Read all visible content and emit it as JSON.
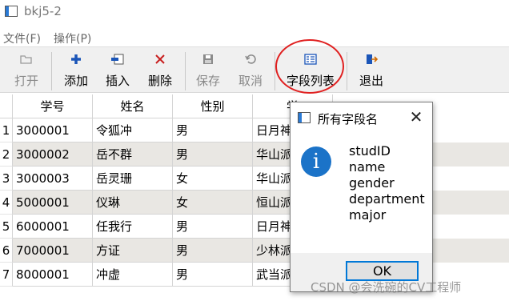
{
  "window": {
    "title": "bkj5-2"
  },
  "menu": {
    "items": [
      "文件(F)",
      "操作(P)"
    ]
  },
  "toolbar": {
    "buttons": [
      {
        "label": "打开",
        "icon": "folder-open-icon",
        "enabled": false
      },
      {
        "label": "添加",
        "icon": "plus-icon",
        "enabled": true
      },
      {
        "label": "插入",
        "icon": "insert-row-icon",
        "enabled": true
      },
      {
        "label": "删除",
        "icon": "delete-x-icon",
        "enabled": true
      },
      {
        "label": "保存",
        "icon": "save-disk-icon",
        "enabled": false
      },
      {
        "label": "取消",
        "icon": "undo-icon",
        "enabled": false
      },
      {
        "label": "字段列表",
        "icon": "field-list-icon",
        "enabled": true
      },
      {
        "label": "退出",
        "icon": "exit-door-icon",
        "enabled": true
      }
    ]
  },
  "table": {
    "headers": [
      "学号",
      "姓名",
      "性别",
      "学"
    ],
    "row_numbers": [
      "1",
      "2",
      "3",
      "4",
      "5",
      "6",
      "7"
    ],
    "rows": [
      [
        "3000001",
        "令狐冲",
        "男",
        "日月神"
      ],
      [
        "3000002",
        "岳不群",
        "男",
        "华山派"
      ],
      [
        "3000003",
        "岳灵珊",
        "女",
        "华山派"
      ],
      [
        "5000001",
        "仪琳",
        "女",
        "恒山派"
      ],
      [
        "6000001",
        "任我行",
        "男",
        "日月神"
      ],
      [
        "7000001",
        "方证",
        "男",
        "少林派"
      ],
      [
        "8000001",
        "冲虚",
        "男",
        "武当派"
      ]
    ]
  },
  "dialog": {
    "title": "所有字段名",
    "icon": "info-icon",
    "icon_glyph": "i",
    "fields": [
      "studID",
      "name",
      "gender",
      "department",
      "major"
    ],
    "ok_label": "OK"
  },
  "watermark": "CSDN @会洗碗的CV工程师",
  "colors": {
    "alt_row": "#e9e7e3",
    "info_blue": "#1b73c8",
    "annotation_red": "#e02020",
    "ok_border": "#0078d7"
  }
}
